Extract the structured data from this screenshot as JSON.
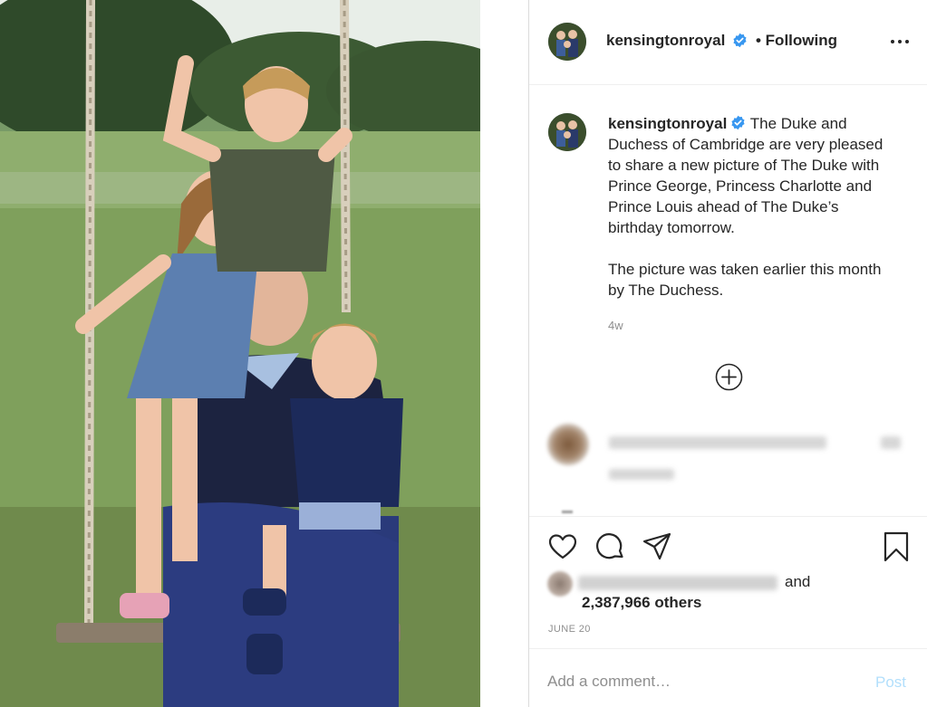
{
  "post": {
    "photo_alt": "",
    "account": {
      "username": "kensingtonroyal",
      "verified": true,
      "follow_status": "• Following"
    },
    "caption": {
      "username": "kensingtonroyal",
      "paragraph_1": "The Duke and Duchess of Cambridge are very pleased to share a new picture of The Duke with Prince George, Princess Charlotte and Prince Louis ahead of The Duke’s birthday tomorrow.",
      "paragraph_2": "The picture was taken earlier this month by The Duchess.",
      "time_ago": "4w"
    },
    "likes": {
      "and_label": "and",
      "others_label": "2,387,966 others"
    },
    "date": "JUNE 20",
    "comment_box": {
      "placeholder": "Add a comment…",
      "post_label": "Post"
    }
  },
  "colors": {
    "verified_badge": "#3897f0",
    "text_primary": "#262626",
    "text_secondary": "#8e8e8e",
    "post_button_disabled": "#b2dffc",
    "divider": "#efefef"
  },
  "icons": {
    "more": "more-horizontal-icon",
    "load_more": "plus-circle-icon",
    "like": "heart-icon",
    "comment": "comment-bubble-icon",
    "share": "paper-plane-icon",
    "save": "bookmark-icon"
  }
}
